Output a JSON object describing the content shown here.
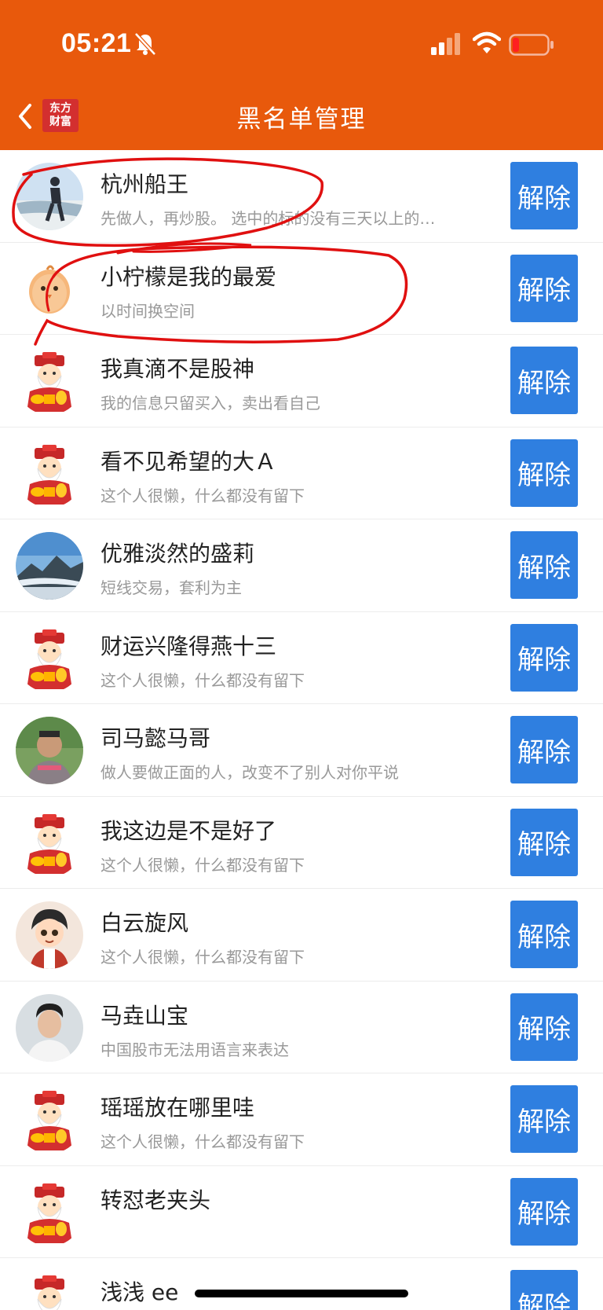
{
  "status_bar": {
    "time": "05:21"
  },
  "header": {
    "title": "黑名单管理",
    "logo_line1": "东方",
    "logo_line2": "财富"
  },
  "colors": {
    "header_bg": "#e8590c",
    "button_bg": "#2f7fe0",
    "annotation": "#e01010"
  },
  "users": [
    {
      "name": "杭州船王",
      "signature": "先做人，再炒股。 选中的标的没有三天以上的…",
      "button": "解除",
      "avatar": "photo-person-beach"
    },
    {
      "name": "小柠檬是我的最爱",
      "signature": "以时间换空间",
      "button": "解除",
      "avatar": "cartoon-orange-chick"
    },
    {
      "name": "我真滴不是股神",
      "signature": "我的信息只留买入，卖出看自己",
      "button": "解除",
      "avatar": "cartoon-fortune-god"
    },
    {
      "name": "看不见希望的大Ａ",
      "signature": "这个人很懒，什么都没有留下",
      "button": "解除",
      "avatar": "cartoon-fortune-god"
    },
    {
      "name": "优雅淡然的盛莉",
      "signature": "短线交易，套利为主",
      "button": "解除",
      "avatar": "photo-mountain-sea"
    },
    {
      "name": "财运兴隆得燕十三",
      "signature": "这个人很懒，什么都没有留下",
      "button": "解除",
      "avatar": "cartoon-fortune-god"
    },
    {
      "name": "司马懿马哥",
      "signature": "做人要做正面的人，改变不了别人对你平说",
      "button": "解除",
      "avatar": "photo-man"
    },
    {
      "name": "我这边是不是好了",
      "signature": "这个人很懒，什么都没有留下",
      "button": "解除",
      "avatar": "cartoon-fortune-god"
    },
    {
      "name": "白云旋风",
      "signature": "这个人很懒，什么都没有留下",
      "button": "解除",
      "avatar": "cartoon-boy"
    },
    {
      "name": "马垚山宝",
      "signature": "中国股市无法用语言来表达",
      "button": "解除",
      "avatar": "photo-young-man"
    },
    {
      "name": "瑶瑶放在哪里哇",
      "signature": "这个人很懒，什么都没有留下",
      "button": "解除",
      "avatar": "cartoon-fortune-god"
    },
    {
      "name": "转怼老夹头",
      "signature": "",
      "button": "解除",
      "avatar": "cartoon-fortune-god"
    },
    {
      "name": "浅浅 ee",
      "signature": "",
      "button": "解除",
      "avatar": "cartoon-fortune-god"
    }
  ]
}
